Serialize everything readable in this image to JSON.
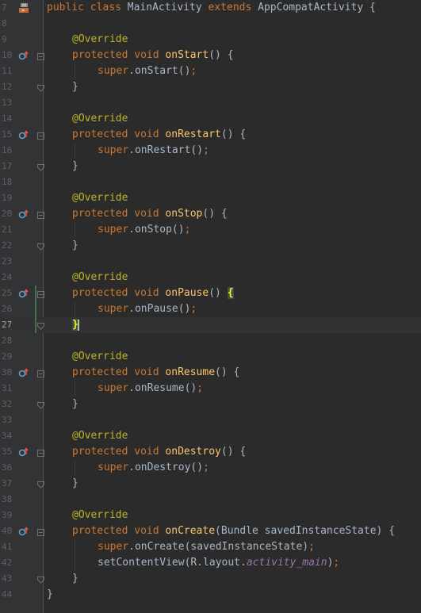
{
  "editor": {
    "current_line": 27,
    "lines": [
      {
        "num": "7",
        "gutter_icon": "class-run-icon",
        "fold": "",
        "tokens": [
          [
            "kw",
            "public "
          ],
          [
            "kw",
            "class "
          ],
          [
            "pl",
            "MainActivity "
          ],
          [
            "kw",
            "extends "
          ],
          [
            "pl",
            "AppCompatActivity {"
          ]
        ]
      },
      {
        "num": "8",
        "tokens": []
      },
      {
        "num": "9",
        "tokens": []
      },
      {
        "num": "10",
        "gutter_icon": "override-icon",
        "fold": "open",
        "tokens": [
          [
            "ind",
            ""
          ],
          [
            "ann",
            "@Override"
          ]
        ],
        "dup": false
      },
      {
        "num": "10",
        "tokens": []
      },
      {
        "num": "11",
        "tokens": []
      }
    ],
    "rows": [
      {
        "n": "7",
        "icon": "class-run-icon",
        "fold": "",
        "t": [
          [
            "kw",
            "public "
          ],
          [
            "kw",
            "class "
          ],
          [
            "pl",
            "MainActivity "
          ],
          [
            "kw",
            "extends "
          ],
          [
            "pl",
            "AppCompatActivity {"
          ]
        ],
        "i": 0
      },
      {
        "n": "8",
        "icon": "",
        "fold": "",
        "t": [],
        "i": 0
      },
      {
        "n": "9",
        "icon": "",
        "fold": "",
        "t": [
          [
            "ann",
            "@Override"
          ]
        ],
        "i": 1
      },
      {
        "n": "10",
        "icon": "override-icon",
        "fold": "open",
        "t": [
          [
            "kw",
            "protected "
          ],
          [
            "kw",
            "void "
          ],
          [
            "fn",
            "onStart"
          ],
          [
            "pl",
            "() {"
          ]
        ],
        "i": 1
      },
      {
        "n": "11",
        "icon": "",
        "fold": "",
        "t": [
          [
            "kw",
            "super"
          ],
          [
            "pl",
            ".onStart()"
          ],
          [
            "semi",
            ";"
          ]
        ],
        "i": 2
      },
      {
        "n": "12",
        "icon": "",
        "fold": "close",
        "t": [
          [
            "pl",
            "}"
          ]
        ],
        "i": 1
      },
      {
        "n": "13",
        "icon": "",
        "fold": "",
        "t": [],
        "i": 0
      },
      {
        "n": "14",
        "icon": "",
        "fold": "",
        "t": [
          [
            "ann",
            "@Override"
          ]
        ],
        "i": 1
      },
      {
        "n": "15",
        "icon": "override-icon",
        "fold": "open",
        "t": [
          [
            "kw",
            "protected "
          ],
          [
            "kw",
            "void "
          ],
          [
            "fn",
            "onRestart"
          ],
          [
            "pl",
            "() {"
          ]
        ],
        "i": 1
      },
      {
        "n": "16",
        "icon": "",
        "fold": "",
        "t": [
          [
            "kw",
            "super"
          ],
          [
            "pl",
            ".onRestart()"
          ],
          [
            "semi",
            ";"
          ]
        ],
        "i": 2
      },
      {
        "n": "17",
        "icon": "",
        "fold": "close",
        "t": [
          [
            "pl",
            "}"
          ]
        ],
        "i": 1
      },
      {
        "n": "18",
        "icon": "",
        "fold": "",
        "t": [],
        "i": 0
      },
      {
        "n": "19",
        "icon": "",
        "fold": "",
        "t": [
          [
            "ann",
            "@Override"
          ]
        ],
        "i": 1
      },
      {
        "n": "20",
        "icon": "override-icon",
        "fold": "open",
        "t": [
          [
            "kw",
            "protected "
          ],
          [
            "kw",
            "void "
          ],
          [
            "fn",
            "onStop"
          ],
          [
            "pl",
            "() {"
          ]
        ],
        "i": 1
      },
      {
        "n": "21",
        "icon": "",
        "fold": "",
        "t": [
          [
            "kw",
            "super"
          ],
          [
            "pl",
            ".onStop()"
          ],
          [
            "semi",
            ";"
          ]
        ],
        "i": 2
      },
      {
        "n": "22",
        "icon": "",
        "fold": "close",
        "t": [
          [
            "pl",
            "}"
          ]
        ],
        "i": 1
      },
      {
        "n": "23",
        "icon": "",
        "fold": "",
        "t": [],
        "i": 0
      },
      {
        "n": "24",
        "icon": "",
        "fold": "",
        "t": [
          [
            "ann",
            "@Override"
          ]
        ],
        "i": 1
      },
      {
        "n": "25",
        "icon": "override-icon",
        "fold": "open",
        "t": [
          [
            "kw",
            "protected "
          ],
          [
            "kw",
            "void "
          ],
          [
            "fn",
            "onPause"
          ],
          [
            "pl",
            "() "
          ],
          [
            "match",
            "{"
          ]
        ],
        "i": 1
      },
      {
        "n": "26",
        "icon": "",
        "fold": "",
        "t": [
          [
            "kw",
            "super"
          ],
          [
            "pl",
            ".onPause()"
          ],
          [
            "semi",
            ";"
          ]
        ],
        "i": 2
      },
      {
        "n": "27",
        "icon": "",
        "fold": "close",
        "t": [
          [
            "match",
            "}"
          ]
        ],
        "i": 1,
        "current": true
      },
      {
        "n": "28",
        "icon": "",
        "fold": "",
        "t": [],
        "i": 0
      },
      {
        "n": "29",
        "icon": "",
        "fold": "",
        "t": [
          [
            "ann",
            "@Override"
          ]
        ],
        "i": 1
      },
      {
        "n": "30",
        "icon": "override-icon",
        "fold": "open",
        "t": [
          [
            "kw",
            "protected "
          ],
          [
            "kw",
            "void "
          ],
          [
            "fn",
            "onResume"
          ],
          [
            "pl",
            "() {"
          ]
        ],
        "i": 1
      },
      {
        "n": "31",
        "icon": "",
        "fold": "",
        "t": [
          [
            "kw",
            "super"
          ],
          [
            "pl",
            ".onResume()"
          ],
          [
            "semi",
            ";"
          ]
        ],
        "i": 2
      },
      {
        "n": "32",
        "icon": "",
        "fold": "close",
        "t": [
          [
            "pl",
            "}"
          ]
        ],
        "i": 1
      },
      {
        "n": "33",
        "icon": "",
        "fold": "",
        "t": [],
        "i": 0
      },
      {
        "n": "34",
        "icon": "",
        "fold": "",
        "t": [
          [
            "ann",
            "@Override"
          ]
        ],
        "i": 1
      },
      {
        "n": "35",
        "icon": "override-icon",
        "fold": "open",
        "t": [
          [
            "kw",
            "protected "
          ],
          [
            "kw",
            "void "
          ],
          [
            "fn",
            "onDestroy"
          ],
          [
            "pl",
            "() {"
          ]
        ],
        "i": 1
      },
      {
        "n": "36",
        "icon": "",
        "fold": "",
        "t": [
          [
            "kw",
            "super"
          ],
          [
            "pl",
            ".onDestroy()"
          ],
          [
            "semi",
            ";"
          ]
        ],
        "i": 2
      },
      {
        "n": "37",
        "icon": "",
        "fold": "close",
        "t": [
          [
            "pl",
            "}"
          ]
        ],
        "i": 1
      },
      {
        "n": "38",
        "icon": "",
        "fold": "",
        "t": [],
        "i": 0
      },
      {
        "n": "39",
        "icon": "",
        "fold": "",
        "t": [
          [
            "ann",
            "@Override"
          ]
        ],
        "i": 1
      },
      {
        "n": "40",
        "icon": "override-icon",
        "fold": "open",
        "t": [
          [
            "kw",
            "protected "
          ],
          [
            "kw",
            "void "
          ],
          [
            "fn",
            "onCreate"
          ],
          [
            "pl",
            "(Bundle savedInstanceState) {"
          ]
        ],
        "i": 1
      },
      {
        "n": "41",
        "icon": "",
        "fold": "",
        "t": [
          [
            "kw",
            "super"
          ],
          [
            "pl",
            ".onCreate(savedInstanceState)"
          ],
          [
            "semi",
            ";"
          ]
        ],
        "i": 2
      },
      {
        "n": "42",
        "icon": "",
        "fold": "",
        "t": [
          [
            "pl",
            "setContentView(R.layout."
          ],
          [
            "field",
            "activity_main"
          ],
          [
            "pl",
            ")"
          ],
          [
            "semi",
            ";"
          ]
        ],
        "i": 2
      },
      {
        "n": "43",
        "icon": "",
        "fold": "close",
        "t": [
          [
            "pl",
            "}"
          ]
        ],
        "i": 1
      },
      {
        "n": "44",
        "icon": "",
        "fold": "",
        "t": [
          [
            "pl",
            "}"
          ]
        ],
        "i": 0
      }
    ]
  },
  "colors": {
    "background": "#2b2b2b",
    "gutter": "#313335",
    "keyword": "#cc7832",
    "annotation": "#bbb529",
    "method": "#ffc66d",
    "text": "#a9b7c6",
    "field": "#9876aa"
  }
}
